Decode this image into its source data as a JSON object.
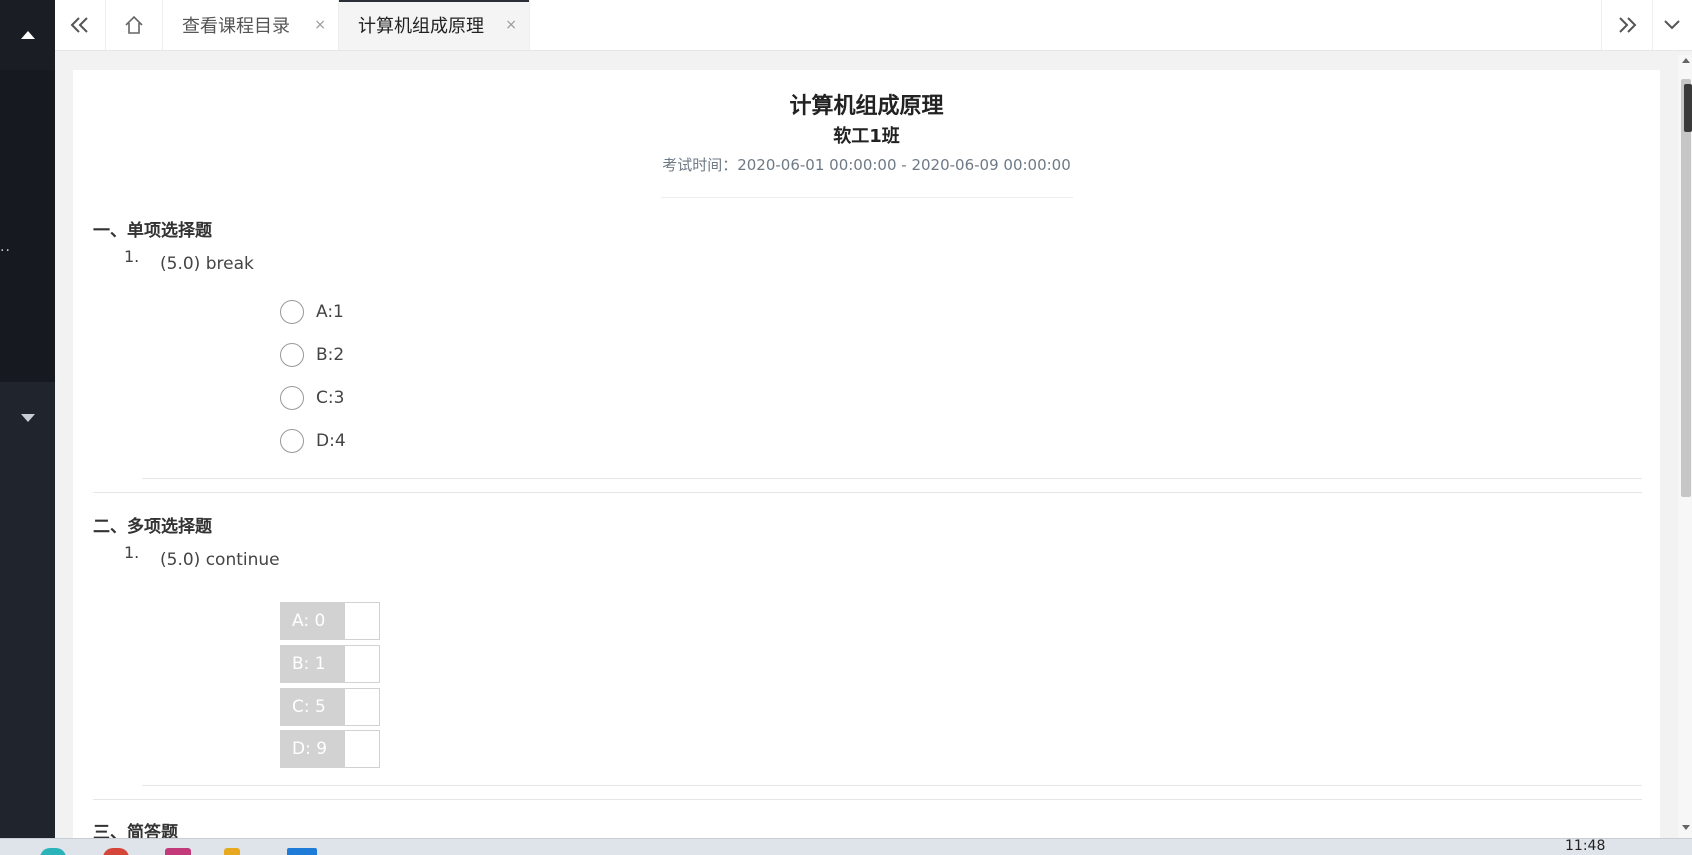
{
  "tabs": [
    {
      "label": "查看课程目录",
      "close": "×"
    },
    {
      "label": "计算机组成原理",
      "close": "×"
    }
  ],
  "sidebar": {
    "dots": "··"
  },
  "exam": {
    "title": "计算机组成原理",
    "class_name": "软工1班",
    "time": "考试时间：2020-06-01 00:00:00 - 2020-06-09 00:00:00"
  },
  "sections": {
    "single": {
      "title": "一、单项选择题",
      "q_num": "1.",
      "question": "(5.0) break",
      "options": [
        "A:1",
        "B:2",
        "C:3",
        "D:4"
      ]
    },
    "multi": {
      "title": "二、多项选择题",
      "q_num": "1.",
      "question": "(5.0) continue",
      "options": [
        "A:  0",
        "B:  1",
        "C:  5",
        "D:  9"
      ]
    },
    "short": {
      "title": "三、简答题"
    }
  },
  "taskbar": {
    "clock": "11:48"
  },
  "colors": {
    "sidebar": "#20242c",
    "accent_tab_bar": "#2b2e36",
    "checkbox_label": "#d2d2d2"
  }
}
